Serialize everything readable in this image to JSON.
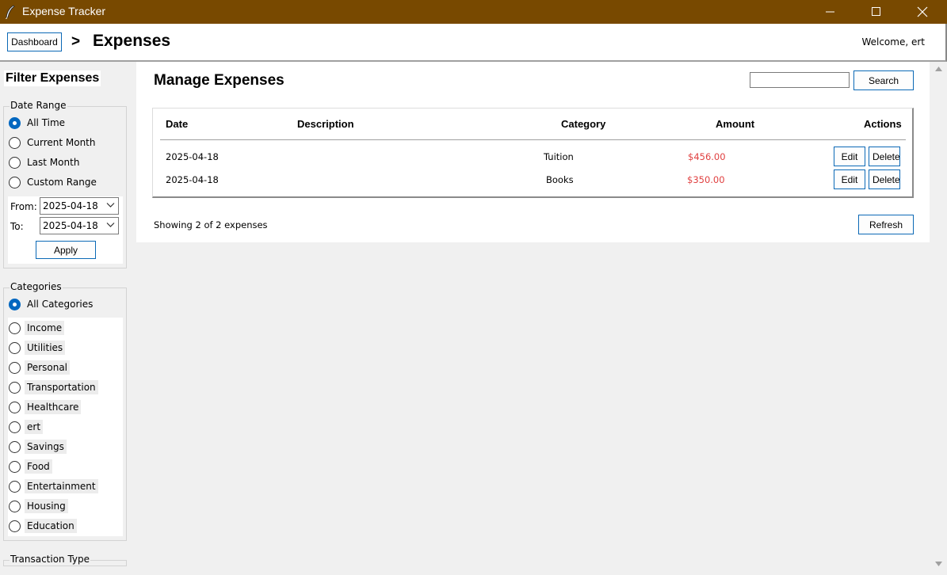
{
  "window": {
    "title": "Expense Tracker"
  },
  "header": {
    "dashboard_label": "Dashboard",
    "separator": ">",
    "page_title": "Expenses",
    "welcome": "Welcome, ert"
  },
  "sidebar": {
    "title": "Filter Expenses",
    "date_range": {
      "label": "Date Range",
      "options": [
        "All Time",
        "Current Month",
        "Last Month",
        "Custom Range"
      ],
      "selected": "All Time",
      "from_label": "From:",
      "from_value": "2025-04-18",
      "to_label": "To:",
      "to_value": "2025-04-18",
      "apply_label": "Apply"
    },
    "categories": {
      "label": "Categories",
      "all_label": "All Categories",
      "items": [
        "Income",
        "Utilities",
        "Personal",
        "Transportation",
        "Healthcare",
        "ert",
        "Savings",
        "Food",
        "Entertainment",
        "Housing",
        "Education"
      ]
    },
    "transaction_type": {
      "label": "Transaction Type"
    }
  },
  "main": {
    "title": "Manage Expenses",
    "search_label": "Search",
    "search_value": "",
    "columns": [
      "Date",
      "Description",
      "Category",
      "Amount",
      "Actions"
    ],
    "rows": [
      {
        "date": "2025-04-18",
        "description": "",
        "category": "Tuition",
        "amount": "$456.00",
        "edit": "Edit",
        "delete": "Delete"
      },
      {
        "date": "2025-04-18",
        "description": "",
        "category": "Books",
        "amount": "$350.00",
        "edit": "Edit",
        "delete": "Delete"
      }
    ],
    "showing": "Showing 2 of 2 expenses",
    "refresh_label": "Refresh"
  },
  "colors": {
    "titlebar": "#784900",
    "accent": "#0067c0",
    "amount": "#e04040"
  }
}
